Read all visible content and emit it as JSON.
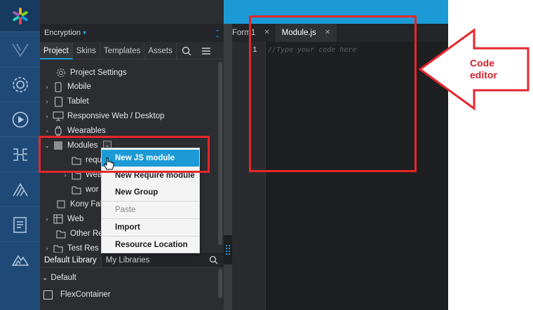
{
  "panel": {
    "encryption_label": "Encryption",
    "tabs": [
      "Project",
      "Skins",
      "Templates",
      "Assets"
    ],
    "tree": [
      {
        "label": "Project Settings",
        "icon": "gear-icon",
        "arrow": ""
      },
      {
        "label": "Mobile",
        "icon": "mobile-icon",
        "arrow": "›"
      },
      {
        "label": "Tablet",
        "icon": "tablet-icon",
        "arrow": "›"
      },
      {
        "label": "Responsive Web / Desktop",
        "icon": "desktop-icon",
        "arrow": "›"
      },
      {
        "label": "Wearables",
        "icon": "watch-icon",
        "arrow": "›"
      },
      {
        "label": "Modules",
        "icon": "module-icon",
        "arrow": "⌄"
      },
      {
        "label": "requ",
        "icon": "folder-icon",
        "arrow": ""
      },
      {
        "label": "Wea",
        "icon": "folder-icon",
        "arrow": "›"
      },
      {
        "label": "wor",
        "icon": "folder-icon",
        "arrow": ""
      },
      {
        "label": "Kony Fab",
        "icon": "cloud-icon",
        "arrow": ""
      },
      {
        "label": "Web",
        "icon": "web-icon",
        "arrow": "›"
      },
      {
        "label": "Other Res",
        "icon": "folder-icon",
        "arrow": ""
      },
      {
        "label": "Test Res",
        "icon": "folder-icon",
        "arrow": "›"
      }
    ]
  },
  "library": {
    "tabs": [
      "Default Library",
      "My Libraries"
    ],
    "group": "Default",
    "items": [
      "FlexContainer"
    ]
  },
  "editor": {
    "tabs": [
      {
        "label": "Form1"
      },
      {
        "label": "Module.js"
      }
    ],
    "line_number": "1",
    "code": "//Type your code here"
  },
  "context_menu": {
    "items": [
      "New JS module",
      "New Require module",
      "New Group",
      "Paste",
      "Import",
      "Resource Location"
    ]
  },
  "annotation": {
    "label_line1": "Code",
    "label_line2": "editor"
  },
  "colors": {
    "accent": "#1c9ad6",
    "annotation_red": "#e6262b",
    "rail": "#1f4a78"
  }
}
